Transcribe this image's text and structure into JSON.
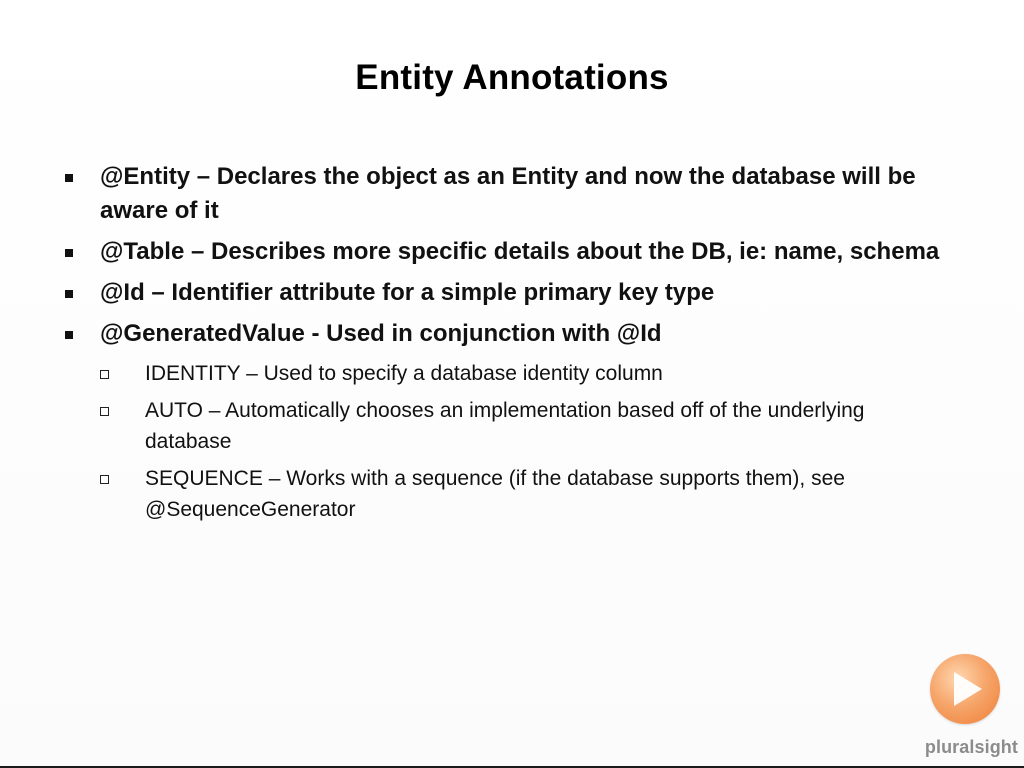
{
  "slide": {
    "title": "Entity Annotations",
    "bullets": [
      {
        "text": "@Entity – Declares the object as an Entity and now the database will be aware of it",
        "subitems": []
      },
      {
        "text": "@Table – Describes more specific details about the DB, ie: name, schema",
        "subitems": []
      },
      {
        "text": "@Id – Identifier attribute for a simple primary key type",
        "subitems": []
      },
      {
        "text": "@GeneratedValue - Used in conjunction with @Id",
        "subitems": [
          "IDENTITY – Used to specify a database identity column",
          "AUTO – Automatically chooses an implementation based off of the underlying database",
          "SEQUENCE – Works with a sequence (if the database supports them), see @SequenceGenerator"
        ]
      }
    ]
  },
  "branding": {
    "logo_icon": "play-icon",
    "logo_text": "pluralsight",
    "accent_color": "#ee7d34"
  }
}
